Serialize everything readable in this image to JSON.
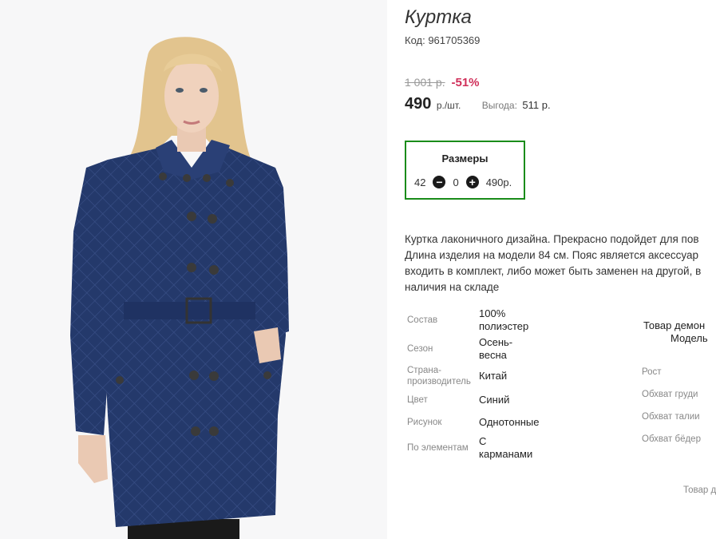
{
  "product": {
    "title": "Куртка",
    "code": "Код: 961705369",
    "old_price": "1 001 р.",
    "discount": "-51%",
    "price": "490",
    "price_unit": "р./шт.",
    "savings_label": "Выгода:",
    "savings_value": "511 р."
  },
  "sizes": {
    "title": "Размеры",
    "size": "42",
    "quantity": "0",
    "row_price": "490р.",
    "minus_icon": "minus-circle-icon",
    "plus_icon": "plus-circle-icon"
  },
  "description": [
    "Куртка лаконичного дизайна. Прекрасно подойдет для пов",
    "Длина изделия на модели 84 см. Пояс является аксессуар",
    "входить в комплект, либо может быть заменен на другой, в",
    "наличия на складе"
  ],
  "attributes": [
    {
      "label": "Состав",
      "value": "100% полиэстер"
    },
    {
      "label": "Сезон",
      "value": "Осень-весна"
    },
    {
      "label": "Страна-производитель",
      "value": "Китай"
    },
    {
      "label": "Цвет",
      "value": "Синий"
    },
    {
      "label": "Рисунок",
      "value": "Однотонные"
    },
    {
      "label": "По элементам",
      "value": "С карманами"
    }
  ],
  "model": {
    "heading_line1": "Товар демон",
    "heading_line2": "Модель",
    "params": [
      "Рост",
      "Обхват груди",
      "Обхват талии",
      "Обхват бёдер"
    ],
    "footer": "Товар д"
  },
  "colors": {
    "sizes_border": "#1a8c1a",
    "discount": "#d0305a",
    "jacket": "#23386a"
  }
}
